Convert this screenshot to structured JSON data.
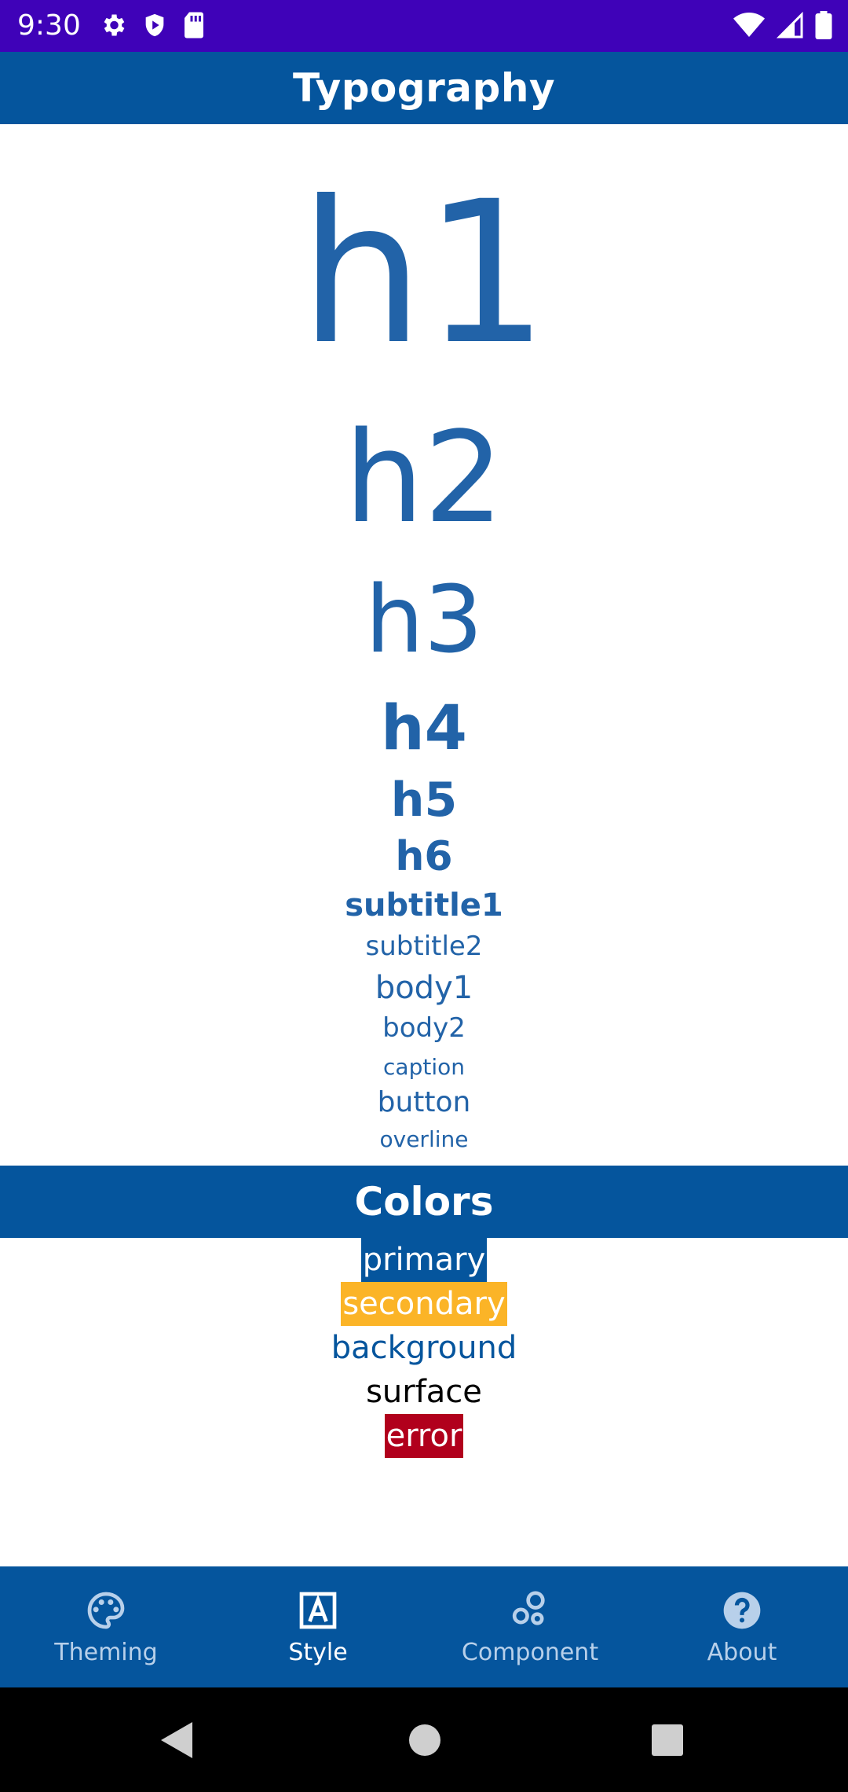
{
  "status_bar": {
    "time": "9:30",
    "left_icons": [
      "gear-icon",
      "shield-icon",
      "sd-card-icon"
    ],
    "right_icons": [
      "wifi-icon",
      "signal-icon",
      "battery-icon"
    ],
    "color": "#3f02b8"
  },
  "app_bar": {
    "title": "Typography",
    "color": "#05559d"
  },
  "typography": {
    "h1": "h1",
    "h2": "h2",
    "h3": "h3",
    "h4": "h4",
    "h5": "h5",
    "h6": "h6",
    "subtitle1": "subtitle1",
    "subtitle2": "subtitle2",
    "body1": "body1",
    "body2": "body2",
    "caption": "caption",
    "button": "button",
    "overline": "overline",
    "text_color": "#2263a8"
  },
  "colors_section": {
    "title": "Colors",
    "items": [
      {
        "label": "primary",
        "color": "#05559d"
      },
      {
        "label": "secondary",
        "color": "#fbb427"
      },
      {
        "label": "background",
        "color": "#ffffff"
      },
      {
        "label": "surface",
        "color": "#ffffff"
      },
      {
        "label": "error",
        "color": "#b1001c"
      }
    ]
  },
  "bottom_nav": {
    "items": [
      {
        "label": "Theming",
        "icon": "palette-icon",
        "active": false
      },
      {
        "label": "Style",
        "icon": "text-format-icon",
        "active": true
      },
      {
        "label": "Component",
        "icon": "bubbles-icon",
        "active": false
      },
      {
        "label": "About",
        "icon": "help-icon",
        "active": false
      }
    ]
  },
  "system_nav": {
    "buttons": [
      "back-icon",
      "home-icon",
      "recents-icon"
    ]
  }
}
